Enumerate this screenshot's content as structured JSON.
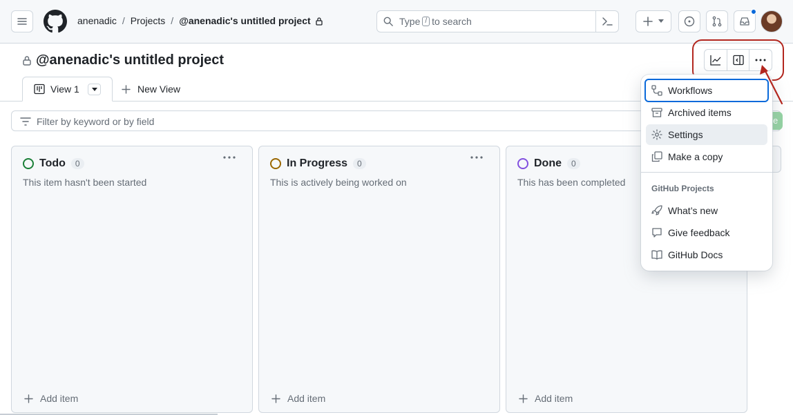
{
  "header": {
    "owner": "anenadic",
    "projects_label": "Projects",
    "project_crumb": "@anenadic's untitled project",
    "search_placeholder_before": "Type",
    "search_key": "/",
    "search_placeholder_after": "to search"
  },
  "project": {
    "title": "@anenadic's untitled project",
    "view_tab": "View 1",
    "new_view": "New View",
    "filter_placeholder": "Filter by keyword or by field"
  },
  "columns": [
    {
      "name": "Todo",
      "count": "0",
      "description": "This item hasn't been started",
      "color": "#1a7f37",
      "add_label": "Add item"
    },
    {
      "name": "In Progress",
      "count": "0",
      "description": "This is actively being worked on",
      "color": "#9a6700",
      "add_label": "Add item"
    },
    {
      "name": "Done",
      "count": "0",
      "description": "This has been completed",
      "color": "#8250df",
      "add_label": "Add item"
    }
  ],
  "menu": {
    "items": [
      "Workflows",
      "Archived items",
      "Settings",
      "Make a copy"
    ],
    "group_label": "GitHub Projects",
    "group_items": [
      "What’s new",
      "Give feedback",
      "GitHub Docs"
    ]
  },
  "colors": {
    "annotation": "#b3261e",
    "focus": "#0969da"
  }
}
